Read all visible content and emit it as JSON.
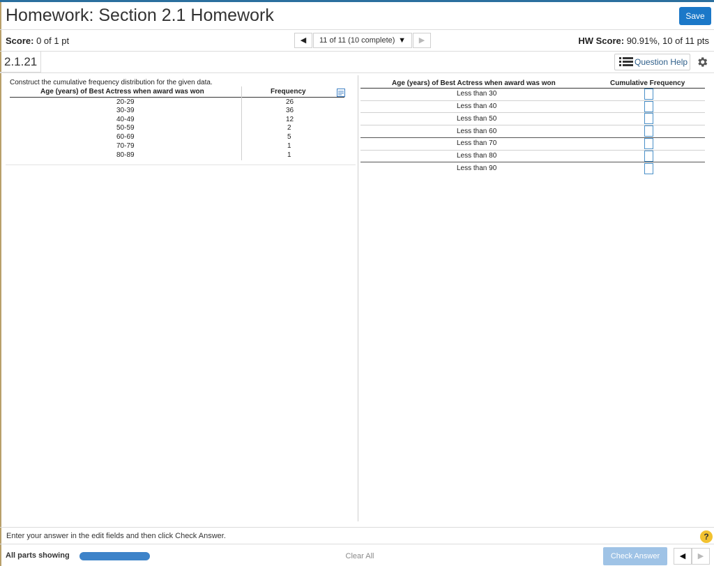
{
  "header": {
    "title": "Homework: Section 2.1 Homework",
    "save_label": "Save",
    "accent_color": "#1b78c8"
  },
  "score_bar": {
    "score_label": "Score:",
    "score_value": "0 of 1 pt",
    "nav_prev_icon": "caret-left-icon",
    "question_select": "11 of 11 (10 complete)",
    "nav_next_icon": "caret-right-icon",
    "hw_score_label": "HW Score:",
    "hw_score_value": "90.91%, 10 of 11 pts"
  },
  "question_bar": {
    "question_id": "2.1.21",
    "help_label": "Question Help",
    "help_icon": "list-icon",
    "settings_icon": "gear-icon"
  },
  "left_panel": {
    "instruction": "Construct the cumulative frequency distribution for the given data.",
    "col_age": "Age (years) of Best Actress when award was won",
    "col_freq": "Frequency",
    "copy_icon": "copy-table-icon",
    "rows": [
      {
        "age": "20-29",
        "freq": "26"
      },
      {
        "age": "30-39",
        "freq": "36"
      },
      {
        "age": "40-49",
        "freq": "12"
      },
      {
        "age": "50-59",
        "freq": "2"
      },
      {
        "age": "60-69",
        "freq": "5"
      },
      {
        "age": "70-79",
        "freq": "1"
      },
      {
        "age": "80-89",
        "freq": "1"
      }
    ]
  },
  "right_panel": {
    "col_age": "Age (years) of Best Actress when award was won",
    "col_cum": "Cumulative Frequency",
    "rows": [
      {
        "label": "Less than 30",
        "value": ""
      },
      {
        "label": "Less than 40",
        "value": ""
      },
      {
        "label": "Less than 50",
        "value": ""
      },
      {
        "label": "Less than 60",
        "value": ""
      },
      {
        "label": "Less than 70",
        "value": ""
      },
      {
        "label": "Less than 80",
        "value": ""
      },
      {
        "label": "Less than 90",
        "value": ""
      }
    ]
  },
  "footer": {
    "message": "Enter your answer in the edit fields and then click Check Answer.",
    "help_glyph": "?",
    "parts_label": "All parts showing",
    "progress_fraction": 1.0,
    "clear_all_label": "Clear All",
    "check_answer_label": "Check Answer"
  }
}
